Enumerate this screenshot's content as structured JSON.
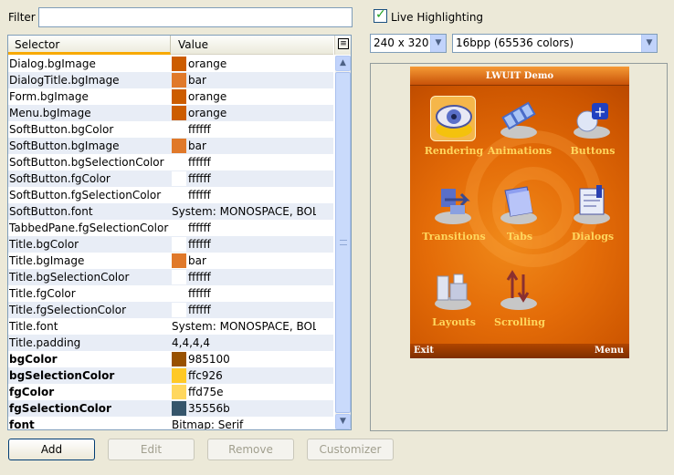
{
  "filter": {
    "label": "Filter",
    "value": ""
  },
  "live_highlighting": {
    "label": "Live Highlighting",
    "checked": true
  },
  "table": {
    "headers": {
      "selector": "Selector",
      "value": "Value"
    },
    "rows": [
      {
        "selector": "Dialog.bgImage",
        "value": "orange",
        "swatch": "#cc5c00",
        "bold": false
      },
      {
        "selector": "DialogTitle.bgImage",
        "value": "bar",
        "swatch": "#e0792a",
        "bold": false
      },
      {
        "selector": "Form.bgImage",
        "value": "orange",
        "swatch": "#cc5c00",
        "bold": false
      },
      {
        "selector": "Menu.bgImage",
        "value": "orange",
        "swatch": "#cc5c00",
        "bold": false
      },
      {
        "selector": "SoftButton.bgColor",
        "value": "ffffff",
        "swatch": "#ffffff",
        "bold": false
      },
      {
        "selector": "SoftButton.bgImage",
        "value": "bar",
        "swatch": "#e0792a",
        "bold": false
      },
      {
        "selector": "SoftButton.bgSelectionColor",
        "value": "ffffff",
        "swatch": "#ffffff",
        "bold": false
      },
      {
        "selector": "SoftButton.fgColor",
        "value": "ffffff",
        "swatch": "#ffffff",
        "bold": false
      },
      {
        "selector": "SoftButton.fgSelectionColor",
        "value": "ffffff",
        "swatch": "#ffffff",
        "bold": false
      },
      {
        "selector": "SoftButton.font",
        "value": "System: MONOSPACE, BOLD...",
        "swatch": "",
        "bold": false
      },
      {
        "selector": "TabbedPane.fgSelectionColor",
        "value": "ffffff",
        "swatch": "#ffffff",
        "bold": false
      },
      {
        "selector": "Title.bgColor",
        "value": "ffffff",
        "swatch": "#ffffff",
        "bold": false
      },
      {
        "selector": "Title.bgImage",
        "value": "bar",
        "swatch": "#e0792a",
        "bold": false
      },
      {
        "selector": "Title.bgSelectionColor",
        "value": "ffffff",
        "swatch": "#ffffff",
        "bold": false
      },
      {
        "selector": "Title.fgColor",
        "value": "ffffff",
        "swatch": "#ffffff",
        "bold": false
      },
      {
        "selector": "Title.fgSelectionColor",
        "value": "ffffff",
        "swatch": "#ffffff",
        "bold": false
      },
      {
        "selector": "Title.font",
        "value": "System: MONOSPACE, BOLD...",
        "swatch": "",
        "bold": false
      },
      {
        "selector": "Title.padding",
        "value": "4,4,4,4",
        "swatch": "",
        "bold": false
      },
      {
        "selector": "bgColor",
        "value": "985100",
        "swatch": "#985100",
        "bold": true
      },
      {
        "selector": "bgSelectionColor",
        "value": "ffc926",
        "swatch": "#ffc926",
        "bold": true
      },
      {
        "selector": "fgColor",
        "value": "ffd75e",
        "swatch": "#ffd75e",
        "bold": true
      },
      {
        "selector": "fgSelectionColor",
        "value": "35556b",
        "swatch": "#35556b",
        "bold": true
      },
      {
        "selector": "font",
        "value": "Bitmap: Serif",
        "swatch": "",
        "bold": true
      }
    ]
  },
  "resolution": {
    "selected": "240 x 320"
  },
  "color_depth": {
    "selected": "16bpp (65536 colors)"
  },
  "preview": {
    "title": "LWUIT Demo",
    "soft_left": "Exit",
    "soft_right": "Menu",
    "apps": [
      {
        "label": "Rendering",
        "icon": "eye-icon",
        "selected": true
      },
      {
        "label": "Animations",
        "icon": "film-icon",
        "selected": false
      },
      {
        "label": "Buttons",
        "icon": "button-plus-icon",
        "selected": false
      },
      {
        "label": "Transitions",
        "icon": "transition-icon",
        "selected": false
      },
      {
        "label": "Tabs",
        "icon": "folder-icon",
        "selected": false
      },
      {
        "label": "Dialogs",
        "icon": "dialog-icon",
        "selected": false
      },
      {
        "label": "Layouts",
        "icon": "layout-blocks-icon",
        "selected": false
      },
      {
        "label": "Scrolling",
        "icon": "scroll-arrows-icon",
        "selected": false
      }
    ]
  },
  "buttons": {
    "add": "Add",
    "edit": "Edit",
    "remove": "Remove",
    "customizer": "Customizer"
  }
}
